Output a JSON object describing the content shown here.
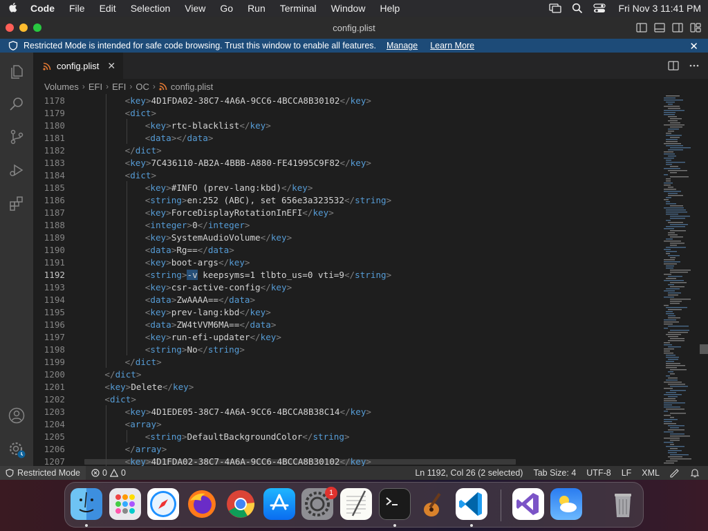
{
  "menubar": {
    "app_name": "Code",
    "items": [
      "File",
      "Edit",
      "Selection",
      "View",
      "Go",
      "Run",
      "Terminal",
      "Window",
      "Help"
    ],
    "clock": "Fri Nov 3  11:41 PM"
  },
  "window": {
    "title": "config.plist"
  },
  "banner": {
    "message": "Restricted Mode is intended for safe code browsing. Trust this window to enable all features.",
    "manage": "Manage",
    "learn_more": "Learn More"
  },
  "tab": {
    "label": "config.plist"
  },
  "breadcrumb": [
    "Volumes",
    "EFI",
    "EFI",
    "OC",
    "config.plist"
  ],
  "editor": {
    "active_line": 1192,
    "lines": [
      {
        "n": "1178",
        "i": 3,
        "segs": [
          [
            "t",
            "<"
          ],
          [
            "k",
            "key"
          ],
          [
            "t",
            ">"
          ],
          [
            "x",
            "4D1FDA02-38C7-4A6A-9CC6-4BCCA8B30102"
          ],
          [
            "t",
            "</"
          ],
          [
            "k",
            "key"
          ],
          [
            "t",
            ">"
          ]
        ]
      },
      {
        "n": "1179",
        "i": 3,
        "segs": [
          [
            "t",
            "<"
          ],
          [
            "k",
            "dict"
          ],
          [
            "t",
            ">"
          ]
        ]
      },
      {
        "n": "1180",
        "i": 4,
        "segs": [
          [
            "t",
            "<"
          ],
          [
            "k",
            "key"
          ],
          [
            "t",
            ">"
          ],
          [
            "x",
            "rtc-blacklist"
          ],
          [
            "t",
            "</"
          ],
          [
            "k",
            "key"
          ],
          [
            "t",
            ">"
          ]
        ]
      },
      {
        "n": "1181",
        "i": 4,
        "segs": [
          [
            "t",
            "<"
          ],
          [
            "k",
            "data"
          ],
          [
            "t",
            "></"
          ],
          [
            "k",
            "data"
          ],
          [
            "t",
            ">"
          ]
        ]
      },
      {
        "n": "1182",
        "i": 3,
        "segs": [
          [
            "t",
            "</"
          ],
          [
            "k",
            "dict"
          ],
          [
            "t",
            ">"
          ]
        ]
      },
      {
        "n": "1183",
        "i": 3,
        "segs": [
          [
            "t",
            "<"
          ],
          [
            "k",
            "key"
          ],
          [
            "t",
            ">"
          ],
          [
            "x",
            "7C436110-AB2A-4BBB-A880-FE41995C9F82"
          ],
          [
            "t",
            "</"
          ],
          [
            "k",
            "key"
          ],
          [
            "t",
            ">"
          ]
        ]
      },
      {
        "n": "1184",
        "i": 3,
        "segs": [
          [
            "t",
            "<"
          ],
          [
            "k",
            "dict"
          ],
          [
            "t",
            ">"
          ]
        ]
      },
      {
        "n": "1185",
        "i": 4,
        "segs": [
          [
            "t",
            "<"
          ],
          [
            "k",
            "key"
          ],
          [
            "t",
            ">"
          ],
          [
            "x",
            "#INFO (prev-lang:kbd)"
          ],
          [
            "t",
            "</"
          ],
          [
            "k",
            "key"
          ],
          [
            "t",
            ">"
          ]
        ]
      },
      {
        "n": "1186",
        "i": 4,
        "segs": [
          [
            "t",
            "<"
          ],
          [
            "k",
            "string"
          ],
          [
            "t",
            ">"
          ],
          [
            "x",
            "en:252 (ABC), set 656e3a323532"
          ],
          [
            "t",
            "</"
          ],
          [
            "k",
            "string"
          ],
          [
            "t",
            ">"
          ]
        ]
      },
      {
        "n": "1187",
        "i": 4,
        "segs": [
          [
            "t",
            "<"
          ],
          [
            "k",
            "key"
          ],
          [
            "t",
            ">"
          ],
          [
            "x",
            "ForceDisplayRotationInEFI"
          ],
          [
            "t",
            "</"
          ],
          [
            "k",
            "key"
          ],
          [
            "t",
            ">"
          ]
        ]
      },
      {
        "n": "1188",
        "i": 4,
        "segs": [
          [
            "t",
            "<"
          ],
          [
            "k",
            "integer"
          ],
          [
            "t",
            ">"
          ],
          [
            "x",
            "0"
          ],
          [
            "t",
            "</"
          ],
          [
            "k",
            "integer"
          ],
          [
            "t",
            ">"
          ]
        ]
      },
      {
        "n": "1189",
        "i": 4,
        "segs": [
          [
            "t",
            "<"
          ],
          [
            "k",
            "key"
          ],
          [
            "t",
            ">"
          ],
          [
            "x",
            "SystemAudioVolume"
          ],
          [
            "t",
            "</"
          ],
          [
            "k",
            "key"
          ],
          [
            "t",
            ">"
          ]
        ]
      },
      {
        "n": "1190",
        "i": 4,
        "segs": [
          [
            "t",
            "<"
          ],
          [
            "k",
            "data"
          ],
          [
            "t",
            ">"
          ],
          [
            "x",
            "Rg=="
          ],
          [
            "t",
            "</"
          ],
          [
            "k",
            "data"
          ],
          [
            "t",
            ">"
          ]
        ]
      },
      {
        "n": "1191",
        "i": 4,
        "segs": [
          [
            "t",
            "<"
          ],
          [
            "k",
            "key"
          ],
          [
            "t",
            ">"
          ],
          [
            "x",
            "boot-args"
          ],
          [
            "t",
            "</"
          ],
          [
            "k",
            "key"
          ],
          [
            "t",
            ">"
          ]
        ]
      },
      {
        "n": "1192",
        "i": 4,
        "segs": [
          [
            "t",
            "<"
          ],
          [
            "k",
            "string"
          ],
          [
            "t",
            ">"
          ],
          [
            "s",
            "-v"
          ],
          [
            "x",
            " keepsyms=1 tlbto_us=0 vti=9"
          ],
          [
            "t",
            "</"
          ],
          [
            "k",
            "string"
          ],
          [
            "t",
            ">"
          ]
        ]
      },
      {
        "n": "1193",
        "i": 4,
        "segs": [
          [
            "t",
            "<"
          ],
          [
            "k",
            "key"
          ],
          [
            "t",
            ">"
          ],
          [
            "x",
            "csr-active-config"
          ],
          [
            "t",
            "</"
          ],
          [
            "k",
            "key"
          ],
          [
            "t",
            ">"
          ]
        ]
      },
      {
        "n": "1194",
        "i": 4,
        "segs": [
          [
            "t",
            "<"
          ],
          [
            "k",
            "data"
          ],
          [
            "t",
            ">"
          ],
          [
            "x",
            "ZwAAAA=="
          ],
          [
            "t",
            "</"
          ],
          [
            "k",
            "data"
          ],
          [
            "t",
            ">"
          ]
        ]
      },
      {
        "n": "1195",
        "i": 4,
        "segs": [
          [
            "t",
            "<"
          ],
          [
            "k",
            "key"
          ],
          [
            "t",
            ">"
          ],
          [
            "x",
            "prev-lang:kbd"
          ],
          [
            "t",
            "</"
          ],
          [
            "k",
            "key"
          ],
          [
            "t",
            ">"
          ]
        ]
      },
      {
        "n": "1196",
        "i": 4,
        "segs": [
          [
            "t",
            "<"
          ],
          [
            "k",
            "data"
          ],
          [
            "t",
            ">"
          ],
          [
            "x",
            "ZW4tVVM6MA=="
          ],
          [
            "t",
            "</"
          ],
          [
            "k",
            "data"
          ],
          [
            "t",
            ">"
          ]
        ]
      },
      {
        "n": "1197",
        "i": 4,
        "segs": [
          [
            "t",
            "<"
          ],
          [
            "k",
            "key"
          ],
          [
            "t",
            ">"
          ],
          [
            "x",
            "run-efi-updater"
          ],
          [
            "t",
            "</"
          ],
          [
            "k",
            "key"
          ],
          [
            "t",
            ">"
          ]
        ]
      },
      {
        "n": "1198",
        "i": 4,
        "segs": [
          [
            "t",
            "<"
          ],
          [
            "k",
            "string"
          ],
          [
            "t",
            ">"
          ],
          [
            "x",
            "No"
          ],
          [
            "t",
            "</"
          ],
          [
            "k",
            "string"
          ],
          [
            "t",
            ">"
          ]
        ]
      },
      {
        "n": "1199",
        "i": 3,
        "segs": [
          [
            "t",
            "</"
          ],
          [
            "k",
            "dict"
          ],
          [
            "t",
            ">"
          ]
        ]
      },
      {
        "n": "1200",
        "i": 2,
        "segs": [
          [
            "t",
            "</"
          ],
          [
            "k",
            "dict"
          ],
          [
            "t",
            ">"
          ]
        ]
      },
      {
        "n": "1201",
        "i": 2,
        "segs": [
          [
            "t",
            "<"
          ],
          [
            "k",
            "key"
          ],
          [
            "t",
            ">"
          ],
          [
            "x",
            "Delete"
          ],
          [
            "t",
            "</"
          ],
          [
            "k",
            "key"
          ],
          [
            "t",
            ">"
          ]
        ]
      },
      {
        "n": "1202",
        "i": 2,
        "segs": [
          [
            "t",
            "<"
          ],
          [
            "k",
            "dict"
          ],
          [
            "t",
            ">"
          ]
        ]
      },
      {
        "n": "1203",
        "i": 3,
        "segs": [
          [
            "t",
            "<"
          ],
          [
            "k",
            "key"
          ],
          [
            "t",
            ">"
          ],
          [
            "x",
            "4D1EDE05-38C7-4A6A-9CC6-4BCCA8B38C14"
          ],
          [
            "t",
            "</"
          ],
          [
            "k",
            "key"
          ],
          [
            "t",
            ">"
          ]
        ]
      },
      {
        "n": "1204",
        "i": 3,
        "segs": [
          [
            "t",
            "<"
          ],
          [
            "k",
            "array"
          ],
          [
            "t",
            ">"
          ]
        ]
      },
      {
        "n": "1205",
        "i": 4,
        "segs": [
          [
            "t",
            "<"
          ],
          [
            "k",
            "string"
          ],
          [
            "t",
            ">"
          ],
          [
            "x",
            "DefaultBackgroundColor"
          ],
          [
            "t",
            "</"
          ],
          [
            "k",
            "string"
          ],
          [
            "t",
            ">"
          ]
        ]
      },
      {
        "n": "1206",
        "i": 3,
        "segs": [
          [
            "t",
            "</"
          ],
          [
            "k",
            "array"
          ],
          [
            "t",
            ">"
          ]
        ]
      },
      {
        "n": "1207",
        "i": 3,
        "segs": [
          [
            "t",
            "<"
          ],
          [
            "k",
            "key"
          ],
          [
            "t",
            ">"
          ],
          [
            "x",
            "4D1FDA02-38C7-4A6A-9CC6-4BCCA8B30102"
          ],
          [
            "t",
            "</"
          ],
          [
            "k",
            "key"
          ],
          [
            "t",
            ">"
          ]
        ]
      }
    ]
  },
  "statusbar": {
    "restricted": "Restricted Mode",
    "errors": "0",
    "warnings": "0",
    "cursor": "Ln 1192, Col 26 (2 selected)",
    "tab_size": "Tab Size: 4",
    "encoding": "UTF-8",
    "eol": "LF",
    "language": "XML"
  },
  "dock": {
    "apps": [
      "finder",
      "launchpad",
      "safari",
      "firefox",
      "chrome",
      "app-store",
      "system-settings",
      "textedit",
      "terminal",
      "garageband",
      "vscode",
      "visual-studio",
      "weather",
      "trash"
    ],
    "system_settings_badge": "1"
  },
  "colors": {
    "banner": "#1d4b78",
    "activity_bar": "#333333",
    "editor_bg": "#1e1e1e",
    "tag_name": "#569cd6",
    "selection": "#264f78"
  }
}
